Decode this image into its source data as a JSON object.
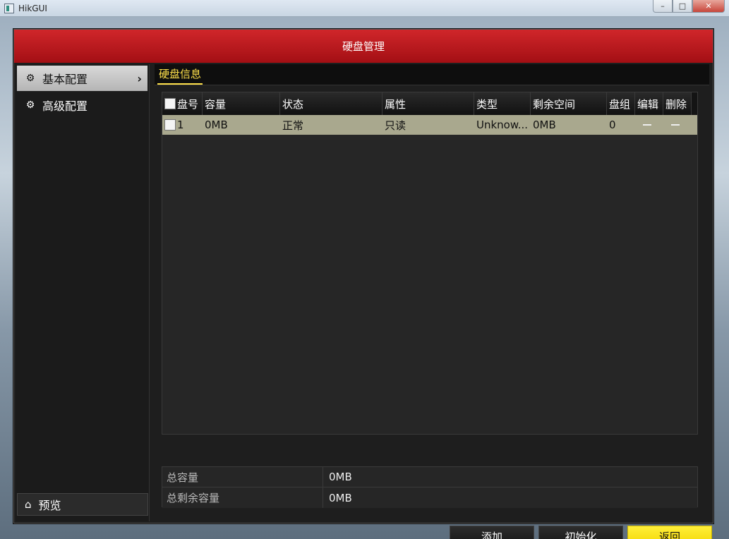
{
  "window": {
    "title": "HikGUI",
    "buttons": [
      "–",
      "□",
      "✕"
    ]
  },
  "dialog": {
    "title": "硬盘管理"
  },
  "sidebar": {
    "items": [
      {
        "label": "基本配置",
        "icon": "gear-icon",
        "active": true
      },
      {
        "label": "高级配置",
        "icon": "gear2-icon",
        "active": false
      }
    ],
    "preview_label": "预览"
  },
  "tabs": [
    {
      "label": "硬盘信息"
    }
  ],
  "table": {
    "headers": [
      "盘号",
      "容量",
      "状态",
      "属性",
      "类型",
      "剩余空间",
      "盘组",
      "编辑",
      "删除"
    ],
    "rows": [
      {
        "id": "1",
        "capacity": "0MB",
        "status": "正常",
        "attribute": "只读",
        "type": "Unknow...",
        "free": "0MB",
        "group": "0"
      }
    ]
  },
  "summary": {
    "total_label": "总容量",
    "total_value": "0MB",
    "free_label": "总剩余容量",
    "free_value": "0MB"
  },
  "buttons": {
    "add": "添加",
    "init": "初始化",
    "back": "返回"
  },
  "colors": {
    "header_red": "#c61b20",
    "accent_yellow": "#ffe14b",
    "row_highlight": "#a9a88e"
  }
}
